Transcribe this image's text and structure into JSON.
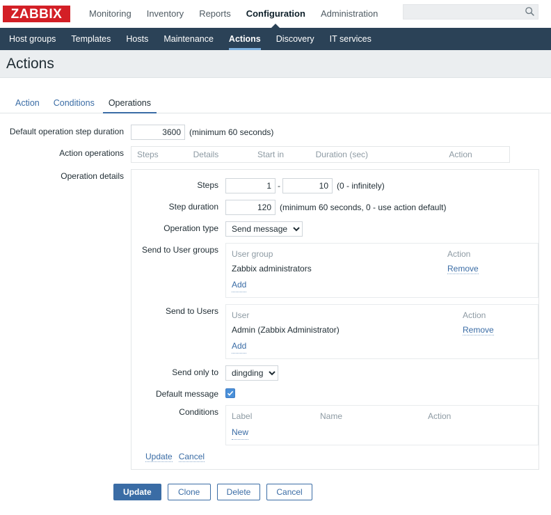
{
  "header": {
    "logo_text": "ZABBIX",
    "menu": [
      {
        "label": "Monitoring",
        "active": false
      },
      {
        "label": "Inventory",
        "active": false
      },
      {
        "label": "Reports",
        "active": false
      },
      {
        "label": "Configuration",
        "active": true
      },
      {
        "label": "Administration",
        "active": false
      }
    ],
    "search": {
      "value": "",
      "placeholder": "",
      "icon": "search-icon"
    }
  },
  "subnav": [
    {
      "label": "Host groups",
      "active": false
    },
    {
      "label": "Templates",
      "active": false
    },
    {
      "label": "Hosts",
      "active": false
    },
    {
      "label": "Maintenance",
      "active": false
    },
    {
      "label": "Actions",
      "active": true
    },
    {
      "label": "Discovery",
      "active": false
    },
    {
      "label": "IT services",
      "active": false
    }
  ],
  "page": {
    "title": "Actions"
  },
  "tabs": [
    {
      "label": "Action",
      "active": false
    },
    {
      "label": "Conditions",
      "active": false
    },
    {
      "label": "Operations",
      "active": true
    }
  ],
  "form": {
    "default_step_duration": {
      "label": "Default operation step duration",
      "value": "3600",
      "hint": "(minimum 60 seconds)"
    },
    "action_operations": {
      "label": "Action operations",
      "columns": [
        "Steps",
        "Details",
        "Start in",
        "Duration (sec)",
        "Action"
      ],
      "rows": []
    },
    "operation_details": {
      "label": "Operation details",
      "steps": {
        "label": "Steps",
        "from": "1",
        "to": "10",
        "separator": "-",
        "hint": "(0 - infinitely)"
      },
      "step_duration": {
        "label": "Step duration",
        "value": "120",
        "hint": "(minimum 60 seconds, 0 - use action default)"
      },
      "operation_type": {
        "label": "Operation type",
        "selected": "Send message",
        "options": [
          "Send message"
        ]
      },
      "send_to_user_groups": {
        "label": "Send to User groups",
        "columns": [
          "User group",
          "Action"
        ],
        "rows": [
          {
            "name": "Zabbix administrators",
            "action": "Remove"
          }
        ],
        "add_label": "Add"
      },
      "send_to_users": {
        "label": "Send to Users",
        "columns": [
          "User",
          "Action"
        ],
        "rows": [
          {
            "name": "Admin (Zabbix Administrator)",
            "action": "Remove"
          }
        ],
        "add_label": "Add"
      },
      "send_only_to": {
        "label": "Send only to",
        "selected": "dingding",
        "options": [
          "dingding"
        ]
      },
      "default_message": {
        "label": "Default message",
        "checked": true
      },
      "conditions": {
        "label": "Conditions",
        "columns": [
          "Label",
          "Name",
          "Action"
        ],
        "rows": [],
        "new_label": "New"
      },
      "links": {
        "update": "Update",
        "cancel": "Cancel"
      }
    }
  },
  "footer": {
    "buttons": [
      {
        "label": "Update",
        "primary": true
      },
      {
        "label": "Clone",
        "primary": false
      },
      {
        "label": "Delete",
        "primary": false
      },
      {
        "label": "Cancel",
        "primary": false
      }
    ]
  }
}
